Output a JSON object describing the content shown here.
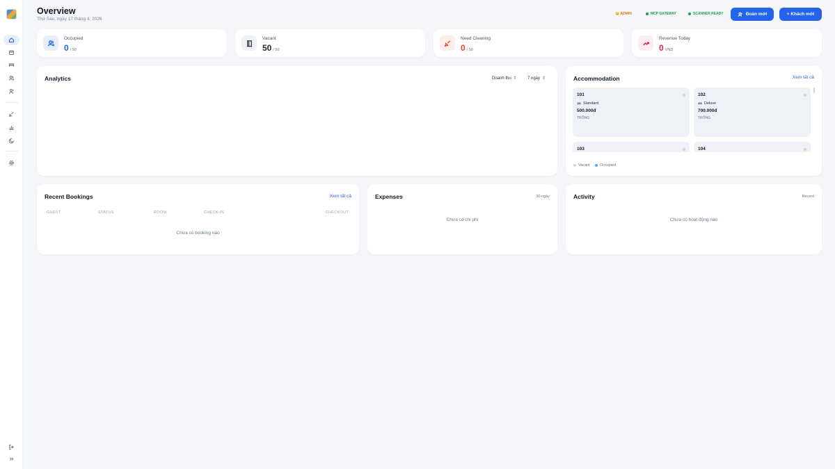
{
  "header": {
    "title": "Overview",
    "date": "Thứ Sáu, ngày 17 tháng 4, 2026",
    "badges": [
      {
        "label": "👑 ADMIN",
        "color": "#d97706"
      },
      {
        "label": "MCP GATEWAY",
        "color": "#16a34a"
      },
      {
        "label": "SCANNER READY",
        "color": "#16a34a"
      }
    ],
    "group_button": "Đoàn mới",
    "new_guest_button": "+ Khách mới"
  },
  "sidebar": {
    "items": [
      "home-icon",
      "calendar-icon",
      "bed-icon",
      "users-icon",
      "user-icon",
      "broom-icon",
      "bar-chart-icon",
      "moon-icon",
      "settings-icon"
    ],
    "bottom": [
      "logout-icon",
      "expand-icon"
    ]
  },
  "stats": [
    {
      "label": "Occupied",
      "value": "0",
      "sub": "/ 50",
      "color": "#2563eb",
      "icon": "users-icon"
    },
    {
      "label": "Vacant",
      "value": "50",
      "sub": "/ 50",
      "color": "#1e293b",
      "icon": "door-icon"
    },
    {
      "label": "Need Cleaning",
      "value": "0",
      "sub": "/ 50",
      "color": "#e0452b",
      "icon": "broom-icon"
    },
    {
      "label": "Revenue Today",
      "value": "0",
      "sub": "VND",
      "color": "#e11d48",
      "icon": "trending-up-icon"
    }
  ],
  "analytics": {
    "title": "Analytics",
    "metric_select": "Doanh thu",
    "range_select": "7 ngày"
  },
  "accommodation": {
    "title": "Accommodation",
    "view_all": "Xem tất cả",
    "rooms": [
      {
        "number": "101",
        "type": "Standard",
        "price": "500.000đ",
        "status": "TRỐNG"
      },
      {
        "number": "102",
        "type": "Deluxe",
        "price": "700.000đ",
        "status": "TRỐNG"
      },
      {
        "number": "103",
        "type": "",
        "price": "",
        "status": ""
      },
      {
        "number": "104",
        "type": "",
        "price": "",
        "status": ""
      }
    ],
    "legend": [
      {
        "label": "Vacant",
        "color": "#cbd5e1"
      },
      {
        "label": "Occupied",
        "color": "#60a5fa"
      }
    ]
  },
  "bookings": {
    "title": "Recent Bookings",
    "view_all": "Xem tất cả",
    "columns": [
      "GUEST",
      "STATUS",
      "ROOM",
      "CHECK-IN",
      "CHECKOUT"
    ],
    "empty": "Chưa có booking nào"
  },
  "expenses": {
    "title": "Expenses",
    "period": "30 ngày",
    "empty": "Chưa có chi phí"
  },
  "activity": {
    "title": "Activity",
    "period": "Recent",
    "empty": "Chưa có hoạt động nào"
  }
}
